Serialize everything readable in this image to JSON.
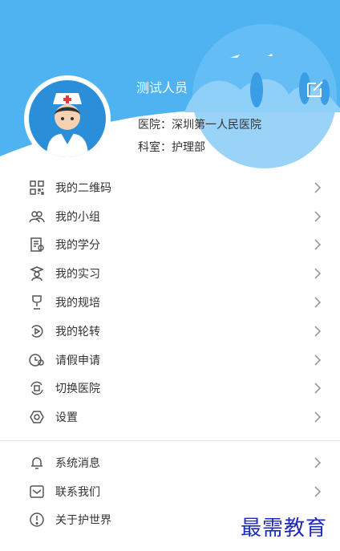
{
  "profile": {
    "name": "测试人员",
    "hospital": "医院：深圳第一人民医院",
    "department": "科室：护理部"
  },
  "menu_primary": [
    {
      "label": "我的二维码",
      "icon": "qr-code-icon"
    },
    {
      "label": "我的小组",
      "icon": "group-icon"
    },
    {
      "label": "我的学分",
      "icon": "credit-icon"
    },
    {
      "label": "我的实习",
      "icon": "graduate-icon"
    },
    {
      "label": "我的规培",
      "icon": "trophy-icon"
    },
    {
      "label": "我的轮转",
      "icon": "rotation-icon"
    },
    {
      "label": "请假申请",
      "icon": "leave-clock-icon"
    },
    {
      "label": "切换医院",
      "icon": "switch-hospital-icon"
    },
    {
      "label": "设置",
      "icon": "gear-icon"
    }
  ],
  "menu_secondary": [
    {
      "label": "系统消息",
      "icon": "bell-icon"
    },
    {
      "label": "联系我们",
      "icon": "mail-icon"
    },
    {
      "label": "关于护世界",
      "icon": "info-icon"
    }
  ],
  "watermark": "最需教育",
  "colors": {
    "header_blue": "#4fb3f2",
    "header_light": "#8fd0f8",
    "avatar_blue": "#2a8fd8",
    "icon_gray": "#555555",
    "chevron_gray": "#999999",
    "watermark": "#1e2bb8"
  }
}
